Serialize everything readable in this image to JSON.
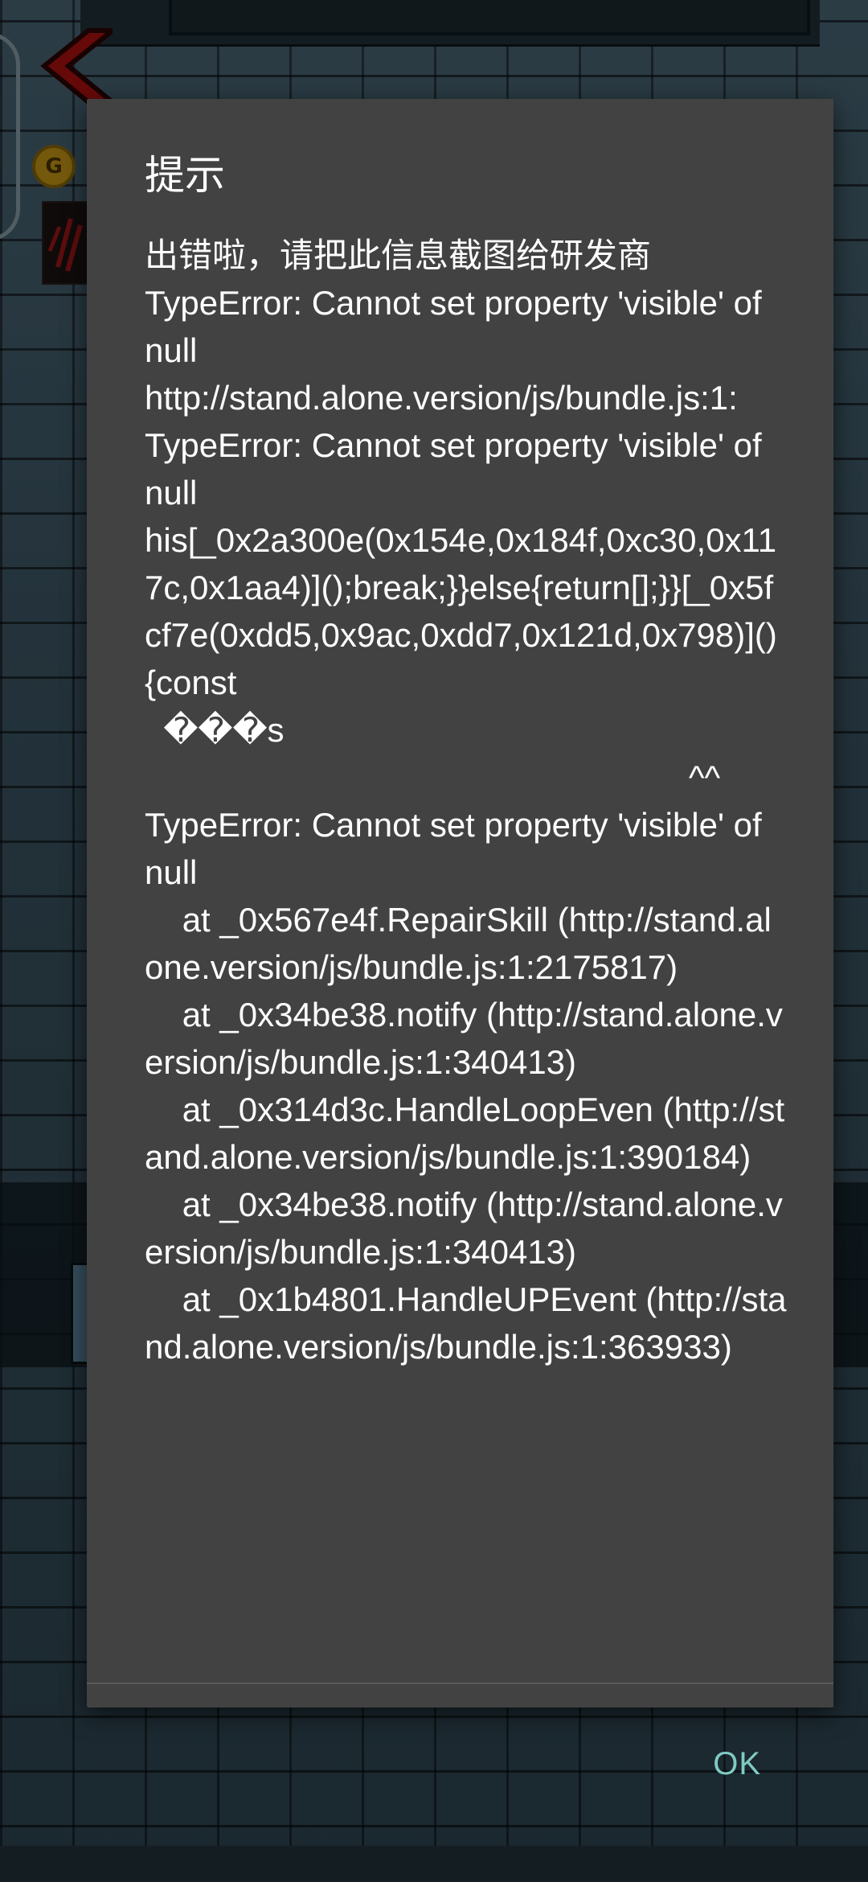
{
  "background": {
    "coin_label": "G"
  },
  "dialog": {
    "title": "提示",
    "message": "出错啦，请把此信息截图给研发商\nTypeError: Cannot set property 'visible' of null\nhttp://stand.alone.version/js/bundle.js:1:\nTypeError: Cannot set property 'visible' of null\nhis[_0x2a300e(0x154e,0x184f,0xc30,0x117c,0x1aa4)]();break;}}else{return[];}}[_0x5fcf7e(0xdd5,0x9ac,0xdd7,0x121d,0x798)](){const\n  ���s\n                                                          ^^\nTypeError: Cannot set property 'visible' of null\n    at _0x567e4f.RepairSkill (http://stand.alone.version/js/bundle.js:1:2175817)\n    at _0x34be38.notify (http://stand.alone.version/js/bundle.js:1:340413)\n    at _0x314d3c.HandleLoopEven (http://stand.alone.version/js/bundle.js:1:390184)\n    at _0x34be38.notify (http://stand.alone.version/js/bundle.js:1:340413)\n    at _0x1b4801.HandleUPEvent (http://stand.alone.version/js/bundle.js:1:363933)",
    "ok_label": "OK"
  },
  "colors": {
    "dialog_bg": "#424242",
    "accent": "#80cbc4",
    "text": "#ffffff"
  }
}
